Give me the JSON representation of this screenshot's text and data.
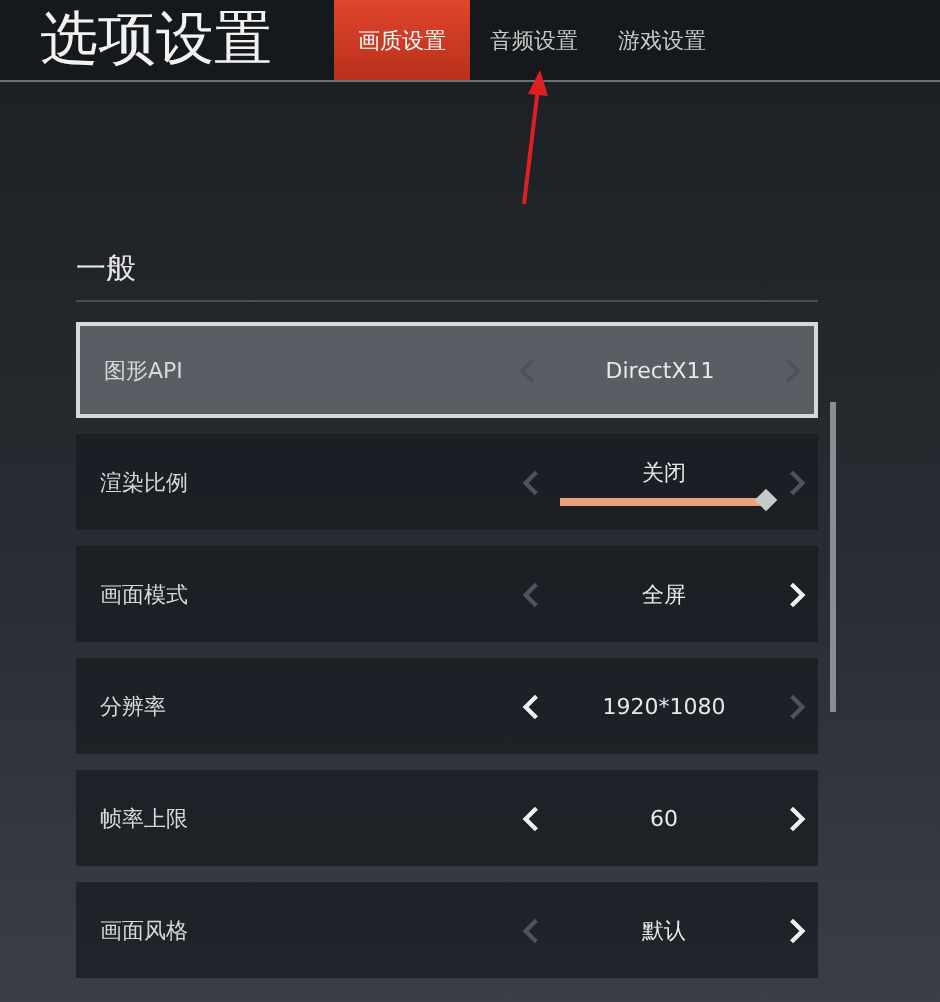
{
  "window": {
    "title": "选项设置"
  },
  "tabs": [
    {
      "label": "画质设置",
      "selected": true
    },
    {
      "label": "音频设置",
      "selected": false
    },
    {
      "label": "游戏设置",
      "selected": false
    }
  ],
  "section": {
    "title": "一般"
  },
  "rows": [
    {
      "kind": "select",
      "label": "图形API",
      "value": "DirectX11",
      "selected": true,
      "prev_enabled": false,
      "next_enabled": false
    },
    {
      "kind": "slider",
      "label": "渲染比例",
      "value": "关闭",
      "selected": false,
      "prev_enabled": false,
      "next_enabled": false,
      "level": 1
    },
    {
      "kind": "select",
      "label": "画面模式",
      "value": "全屏",
      "selected": false,
      "prev_enabled": false,
      "next_enabled": true
    },
    {
      "kind": "select",
      "label": "分辨率",
      "value": "1920*1080",
      "selected": false,
      "prev_enabled": true,
      "next_enabled": false
    },
    {
      "kind": "select",
      "label": "帧率上限",
      "value": "60",
      "selected": false,
      "prev_enabled": true,
      "next_enabled": true
    },
    {
      "kind": "select",
      "label": "画面风格",
      "value": "默认",
      "selected": false,
      "prev_enabled": false,
      "next_enabled": true
    }
  ]
}
